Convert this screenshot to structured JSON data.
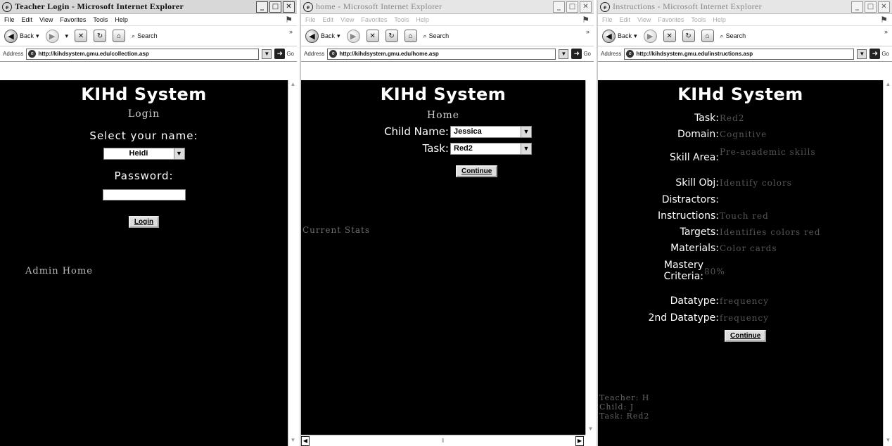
{
  "windows": [
    {
      "title": "Teacher Login - Microsoft Internet Explorer",
      "menu": [
        "File",
        "Edit",
        "View",
        "Favorites",
        "Tools",
        "Help"
      ],
      "toolbar": {
        "back": "Back",
        "search": "Search"
      },
      "address": {
        "label": "Address",
        "url": "http://kihdsystem.gmu.edu/collection.asp",
        "go": "Go"
      },
      "page": {
        "heading": "KIHd System",
        "subheading": "Login",
        "select_label": "Select your name:",
        "selected_name": "Heidi",
        "password_label": "Password:",
        "password_value": "",
        "login_button": "Login",
        "admin_link": "Admin Home"
      }
    },
    {
      "title": "home - Microsoft Internet Explorer",
      "menu": [
        "File",
        "Edit",
        "View",
        "Favorites",
        "Tools",
        "Help"
      ],
      "toolbar": {
        "back": "Back",
        "search": "Search"
      },
      "address": {
        "label": "Address",
        "url": "http://kihdsystem.gmu.edu/home.asp",
        "go": "Go"
      },
      "page": {
        "heading": "KIHd System",
        "subheading": "Home",
        "child_label": "Child Name:",
        "child_value": "Jessica",
        "task_label": "Task:",
        "task_value": "Red2",
        "continue_button": "Continue",
        "current_text": "Current Stats"
      }
    },
    {
      "title": "Instructions - Microsoft Internet Explorer",
      "menu": [
        "File",
        "Edit",
        "View",
        "Favorites",
        "Tools",
        "Help"
      ],
      "toolbar": {
        "back": "Back",
        "search": "Search"
      },
      "address": {
        "label": "Address",
        "url": "http://kihdsystem.gmu.edu/instructions.asp",
        "go": "Go"
      },
      "page": {
        "heading": "KIHd System",
        "rows": [
          {
            "label": "Task:",
            "value": "Red2"
          },
          {
            "label": "Domain:",
            "value": "Cognitive"
          },
          {
            "label": "Skill Area:",
            "value": "Pre-academic skills"
          },
          {
            "label": "Skill Obj:",
            "value": "Identify colors"
          },
          {
            "label": "Distractors:",
            "value": ""
          },
          {
            "label": "Instructions:",
            "value": "Touch red"
          },
          {
            "label": "Targets:",
            "value": "Identifies colors red"
          },
          {
            "label": "Materials:",
            "value": "Color cards"
          },
          {
            "label": "Mastery Criteria:",
            "value": "80%"
          },
          {
            "label": "Datatype:",
            "value": "frequency"
          },
          {
            "label": "2nd Datatype:",
            "value": "frequency"
          }
        ],
        "continue_button": "Continue",
        "footer": [
          "Teacher: H",
          "Child: J",
          "Task: Red2"
        ]
      }
    }
  ]
}
